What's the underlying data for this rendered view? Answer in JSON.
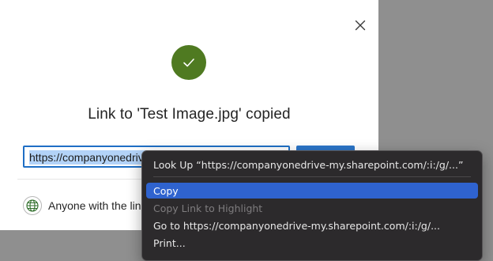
{
  "dialog": {
    "title": "Link to 'Test Image.jpg' copied",
    "link_url": "https://companyonedrive-my.sharepoint.com/:i:/g/personal/testuser",
    "access_label": "Anyone with the link can view"
  },
  "context_menu": {
    "items": [
      {
        "label": "Look Up “https://companyonedrive-my.sharepoint.com/:i:/g/...”"
      },
      {
        "label": "Copy"
      },
      {
        "label": "Copy Link to Highlight"
      },
      {
        "label": "Go to https://companyonedrive-my.sharepoint.com/:i:/g/..."
      },
      {
        "label": "Print..."
      }
    ]
  },
  "colors": {
    "success_green": "#4f7a21",
    "accent_blue": "#2b75c8",
    "menu_highlight": "#2f63cf",
    "menu_background": "#2c2a2c"
  },
  "icons": [
    "close-icon",
    "checkmark-icon",
    "globe-icon"
  ]
}
